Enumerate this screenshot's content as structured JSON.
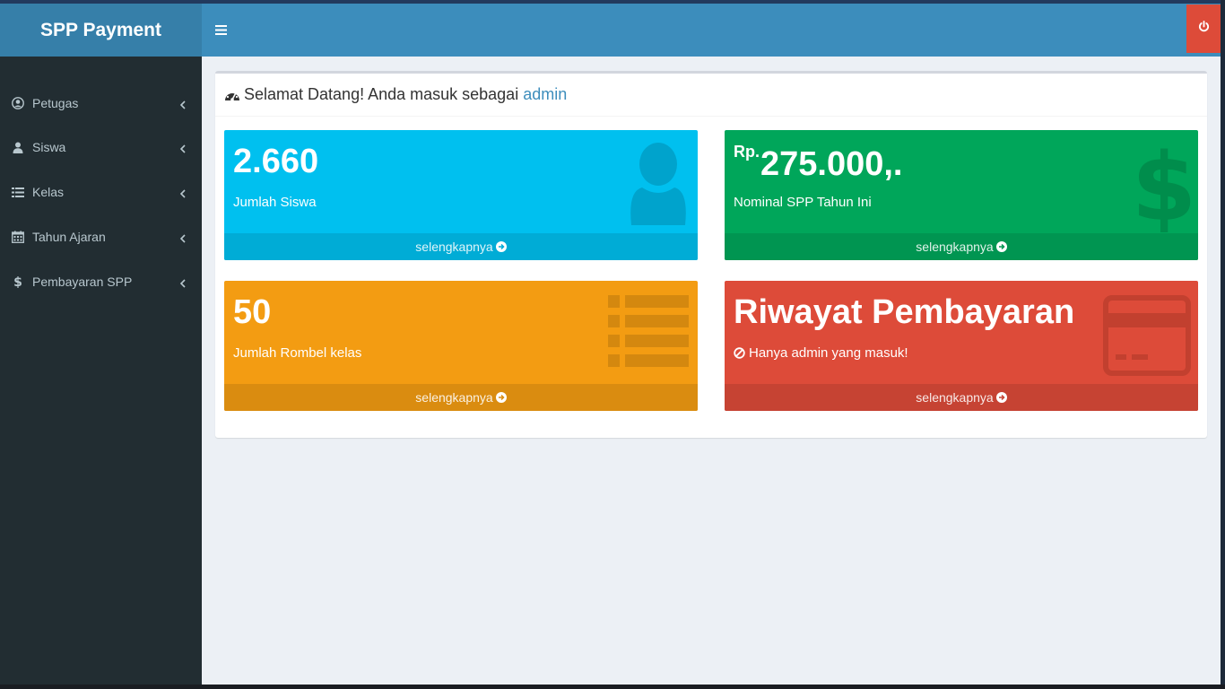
{
  "app": {
    "brand": "SPP Payment"
  },
  "header": {
    "menu_icon": "bars-icon",
    "logout_icon": "power-icon",
    "logout_color": "#dd4b39"
  },
  "sidebar": {
    "items": [
      {
        "label": "Petugas",
        "icon": "user-circle-icon"
      },
      {
        "label": "Siswa",
        "icon": "user-icon"
      },
      {
        "label": "Kelas",
        "icon": "list-icon"
      },
      {
        "label": "Tahun Ajaran",
        "icon": "calendar-icon"
      },
      {
        "label": "Pembayaran SPP",
        "icon": "dollar-icon"
      }
    ]
  },
  "welcome": {
    "text": "Selamat Datang! Anda masuk sebagai",
    "user": "admin",
    "icon": "dashboard-icon"
  },
  "tiles": [
    {
      "value": "2.660",
      "label": "Jumlah Siswa",
      "footer": "selengkapnya",
      "color": "#00c0ef",
      "icon": "user-icon"
    },
    {
      "prefix": "Rp.",
      "value": "275.000,.",
      "label": "Nominal SPP Tahun Ini",
      "footer": "selengkapnya",
      "color": "#00a65a",
      "icon": "dollar-icon"
    },
    {
      "value": "50",
      "label": "Jumlah Rombel kelas",
      "footer": "selengkapnya",
      "color": "#f39c12",
      "icon": "list-icon"
    },
    {
      "value": "Riwayat Pembayaran",
      "label": "Hanya admin yang masuk!",
      "footer": "selengkapnya",
      "color": "#dd4b39",
      "icon": "credit-card-icon"
    }
  ],
  "colors": {
    "navbar": "#3c8dbc",
    "logo_bg": "#367fa9",
    "sidebar_bg": "#222d32",
    "content_bg": "#ecf0f5"
  }
}
